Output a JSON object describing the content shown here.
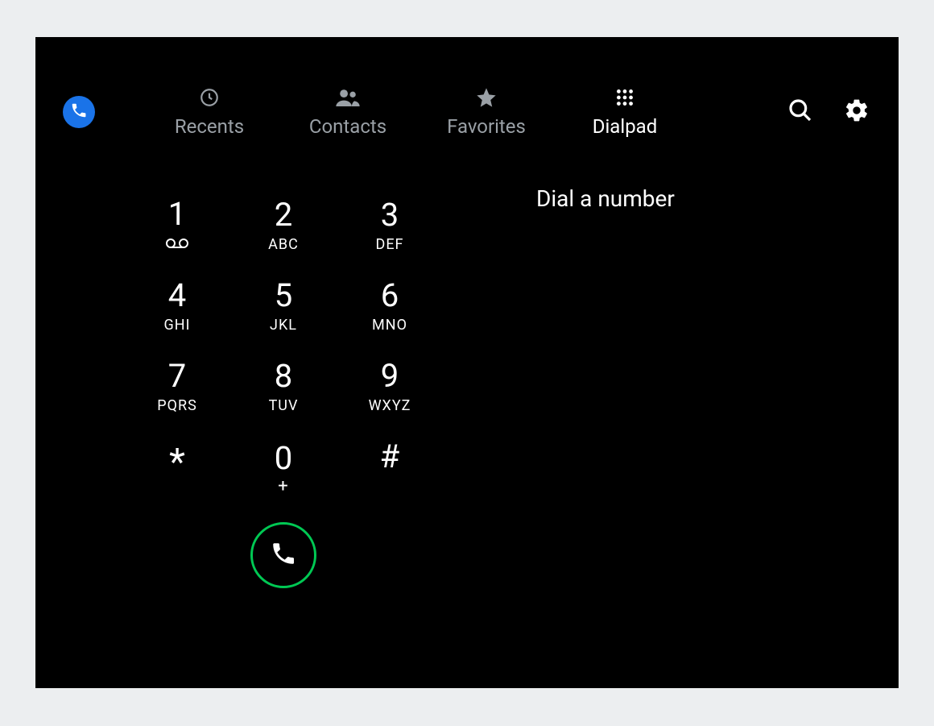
{
  "tabs": {
    "recents": "Recents",
    "contacts": "Contacts",
    "favorites": "Favorites",
    "dialpad": "Dialpad"
  },
  "info": {
    "prompt": "Dial a number"
  },
  "keys": {
    "k1": {
      "digit": "1",
      "sub": ""
    },
    "k2": {
      "digit": "2",
      "sub": "ABC"
    },
    "k3": {
      "digit": "3",
      "sub": "DEF"
    },
    "k4": {
      "digit": "4",
      "sub": "GHI"
    },
    "k5": {
      "digit": "5",
      "sub": "JKL"
    },
    "k6": {
      "digit": "6",
      "sub": "MNO"
    },
    "k7": {
      "digit": "7",
      "sub": "PQRS"
    },
    "k8": {
      "digit": "8",
      "sub": "TUV"
    },
    "k9": {
      "digit": "9",
      "sub": "WXYZ"
    },
    "kstar": {
      "digit": "*",
      "sub": ""
    },
    "k0": {
      "digit": "0",
      "sub": "+"
    },
    "khash": {
      "digit": "#",
      "sub": ""
    }
  },
  "colors": {
    "accent_blue": "#1a73e8",
    "call_green": "#00c853",
    "inactive": "#9aa0a6"
  }
}
